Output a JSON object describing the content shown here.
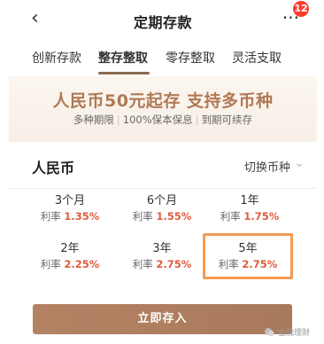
{
  "header": {
    "back_icon": "‹",
    "title": "定期存款",
    "more_icon": "···",
    "badge_count": "12"
  },
  "tabs": [
    {
      "label": "创新存款"
    },
    {
      "label": "整存整取"
    },
    {
      "label": "零存整取"
    },
    {
      "label": "灵活支取"
    }
  ],
  "banner": {
    "main": "人民币50元起存 支持多币种",
    "sub": [
      "多种期限",
      "100%保本保息",
      "到期可续存"
    ]
  },
  "card": {
    "currency": "人民币",
    "switch_label": "切换币种",
    "switch_icon": "chevron-down-icon",
    "rate_label": "利率",
    "terms": [
      {
        "period": "3个月",
        "rate": "1.35",
        "unit": "%"
      },
      {
        "period": "6个月",
        "rate": "1.55",
        "unit": "%"
      },
      {
        "period": "1年",
        "rate": "1.75",
        "unit": "%"
      },
      {
        "period": "2年",
        "rate": "2.25",
        "unit": "%"
      },
      {
        "period": "3年",
        "rate": "2.75",
        "unit": "%"
      },
      {
        "period": "5年",
        "rate": "2.75",
        "unit": "%"
      }
    ]
  },
  "cta": {
    "label": "立即存入"
  },
  "watermark": {
    "text": "金融理财"
  },
  "colors": {
    "accent_brown": "#b07a55",
    "rate_red": "#e05b3d",
    "highlight_orange": "#f29b53",
    "badge_red": "#ff3b30"
  }
}
